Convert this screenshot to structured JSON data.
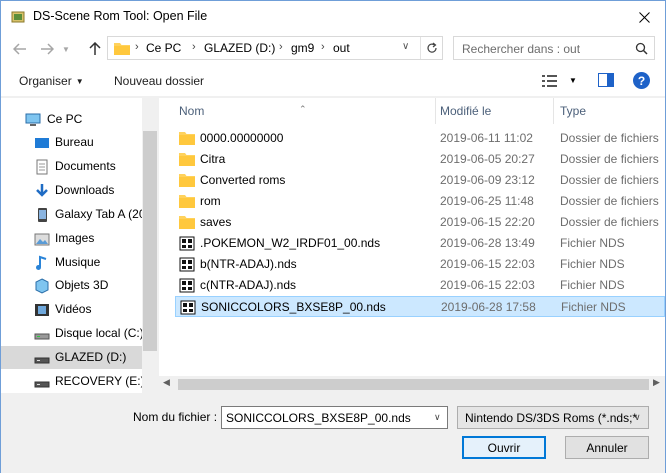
{
  "window": {
    "title": "DS-Scene Rom Tool: Open File"
  },
  "address": {
    "crumbs": [
      "Ce PC",
      "GLAZED (D:)",
      "gm9",
      "out"
    ]
  },
  "search": {
    "placeholder": "Rechercher dans : out"
  },
  "toolbar": {
    "organize_label": "Organiser",
    "new_folder_label": "Nouveau dossier"
  },
  "nav": {
    "items": [
      {
        "label": "Ce PC",
        "icon": "computer-icon"
      },
      {
        "label": "Bureau",
        "icon": "desktop-icon"
      },
      {
        "label": "Documents",
        "icon": "documents-icon"
      },
      {
        "label": "Downloads",
        "icon": "download-icon"
      },
      {
        "label": "Galaxy Tab A (20",
        "icon": "tablet-icon"
      },
      {
        "label": "Images",
        "icon": "images-icon"
      },
      {
        "label": "Musique",
        "icon": "music-icon"
      },
      {
        "label": "Objets 3D",
        "icon": "objects3d-icon"
      },
      {
        "label": "Vidéos",
        "icon": "videos-icon"
      },
      {
        "label": "Disque local (C:)",
        "icon": "drive-icon"
      },
      {
        "label": "GLAZED (D:)",
        "icon": "drive-icon",
        "selected": true
      },
      {
        "label": "RECOVERY (E:)",
        "icon": "drive-icon"
      }
    ]
  },
  "columns": {
    "name": "Nom",
    "modified": "Modifié le",
    "type": "Type"
  },
  "files": [
    {
      "name": "0000.00000000",
      "date": "2019-06-11 11:02",
      "type": "Dossier de fichiers",
      "icon": "folder-icon"
    },
    {
      "name": "Citra",
      "date": "2019-06-05 20:27",
      "type": "Dossier de fichiers",
      "icon": "folder-icon"
    },
    {
      "name": "Converted roms",
      "date": "2019-06-09 23:12",
      "type": "Dossier de fichiers",
      "icon": "folder-icon"
    },
    {
      "name": "rom",
      "date": "2019-06-25 11:48",
      "type": "Dossier de fichiers",
      "icon": "folder-icon"
    },
    {
      "name": "saves",
      "date": "2019-06-15 22:20",
      "type": "Dossier de fichiers",
      "icon": "folder-icon"
    },
    {
      "name": ".POKEMON_W2_IRDF01_00.nds",
      "date": "2019-06-28 13:49",
      "type": "Fichier NDS",
      "icon": "nds-file-icon"
    },
    {
      "name": "b(NTR-ADAJ).nds",
      "date": "2019-06-15 22:03",
      "type": "Fichier NDS",
      "icon": "nds-file-icon"
    },
    {
      "name": "c(NTR-ADAJ).nds",
      "date": "2019-06-15 22:03",
      "type": "Fichier NDS",
      "icon": "nds-file-icon"
    },
    {
      "name": "SONICCOLORS_BXSE8P_00.nds",
      "date": "2019-06-28 17:58",
      "type": "Fichier NDS",
      "icon": "nds-file-icon",
      "selected": true
    }
  ],
  "bottom": {
    "filename_label": "Nom du fichier :",
    "filename_value": "SONICCOLORS_BXSE8P_00.nds",
    "filter_value": "Nintendo DS/3DS Roms (*.nds;*",
    "open_label": "Ouvrir",
    "cancel_label": "Annuler"
  },
  "colors": {
    "accent": "#0078d7",
    "selection": "#cce8ff",
    "folder": "#ffd25c"
  }
}
